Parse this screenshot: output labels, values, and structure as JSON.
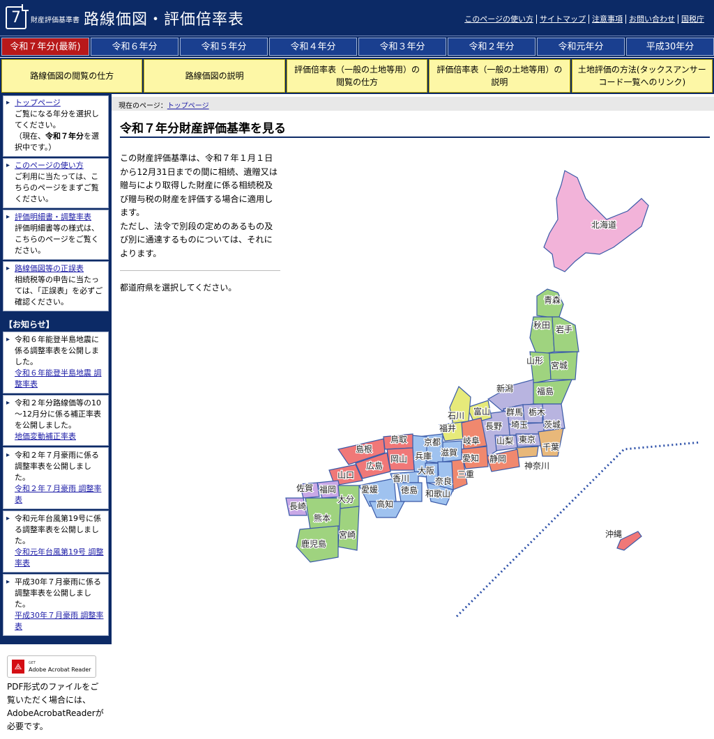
{
  "header": {
    "logo_number": "7",
    "subtitle": "財産評価基準書",
    "title": "路線価図・評価倍率表",
    "links": [
      "このページの使い方",
      "サイトマップ",
      "注意事項",
      "お問い合わせ",
      "国税庁"
    ]
  },
  "year_tabs": [
    "令和７年分(最新)",
    "令和６年分",
    "令和５年分",
    "令和４年分",
    "令和３年分",
    "令和２年分",
    "令和元年分",
    "平成30年分"
  ],
  "nav": [
    "路線価図の閲覧の仕方",
    "路線価図の説明",
    "評価倍率表（一般の土地等用）の閲覧の仕方",
    "評価倍率表（一般の土地等用）の説明",
    "土地評価の方法(タックスアンサーコード一覧へのリンク)"
  ],
  "sidebar": {
    "items": [
      {
        "link": "トップページ",
        "text": "ご覧になる年分を選択してください。",
        "note_pre": "（現在、",
        "note_bold": "令和７年分",
        "note_post": "を選択中です。）"
      },
      {
        "link": "このページの使い方",
        "text": "ご利用に当たっては、こちらのページをまずご覧ください。"
      },
      {
        "link": "評価明細書・調整率表",
        "text": "評価明細書等の様式は、こちらのページをご覧ください。"
      },
      {
        "link": "路線価図等の正誤表",
        "text": "相続税等の申告に当たっては、「正誤表」を必ずご確認ください。"
      }
    ],
    "news_heading": "【お知らせ】",
    "news": [
      {
        "text": "令和６年能登半島地震に係る調整率表を公開しました。",
        "link": "令和６年能登半島地震 調整率表"
      },
      {
        "text": "令和２年分路線価等の10～12月分に係る補正率表を公開しました。",
        "link": "地価変動補正率表"
      },
      {
        "text": "令和２年７月豪雨に係る調整率表を公開しました。",
        "link": "令和２年７月豪雨 調整率表"
      },
      {
        "text": "令和元年台風第19号に係る調整率表を公開しました。",
        "link": "令和元年台風第19号 調整率表"
      },
      {
        "text": "平成30年７月豪雨に係る調整率表を公開しました。",
        "link": "平成30年７月豪雨 調整率表"
      }
    ],
    "acrobat": {
      "get": "GET",
      "name": "Adobe Acrobat Reader",
      "desc": "PDF形式のファイルをご覧いただく場合には、AdobeAcrobatReaderが必要です。"
    }
  },
  "breadcrumb": {
    "prefix": "現在のページ：",
    "current": "トップページ"
  },
  "main": {
    "title": "令和７年分財産評価基準を見る",
    "intro1": "この財産評価基準は、令和７年１月１日から12月31日までの間に相続、遺贈又は贈与により取得した財産に係る相続税及び贈与税の財産を評価する場合に適用します。",
    "intro2": "ただし、法令で別段の定めのあるもの及び別に通達するものについては、それによります。",
    "select": "都道府県を選択してください。"
  },
  "map": {
    "colors": {
      "hokkaido": "#f2b3d9",
      "tohoku": "#9fd37f",
      "kanto": "#b8b4e0",
      "chubu": "#b8b4e0",
      "hokuriku": "#e6ea7a",
      "tokai": "#f0886e",
      "kinki": "#9fc2ef",
      "chugoku": "#f07878",
      "shikoku": "#9fc2ef",
      "kyushu": "#9fd37f",
      "northkyushu": "#c9a8e6",
      "okinawa": "#f07878",
      "chiba": "#e8b87a"
    },
    "labels": [
      "北海道",
      "青森",
      "秋田",
      "岩手",
      "山形",
      "宮城",
      "新潟",
      "福島",
      "石川",
      "富山",
      "群馬",
      "栃木",
      "福井",
      "長野",
      "埼玉",
      "茨城",
      "岐阜",
      "山梨",
      "東京",
      "千葉",
      "神奈川",
      "静岡",
      "愛知",
      "三重",
      "京都",
      "滋賀",
      "奈良",
      "和歌山",
      "大阪",
      "兵庫",
      "鳥取",
      "島根",
      "岡山",
      "広島",
      "山口",
      "香川",
      "徳島",
      "愛媛",
      "高知",
      "福岡",
      "佐賀",
      "長崎",
      "大分",
      "熊本",
      "宮崎",
      "鹿児島",
      "沖縄"
    ]
  }
}
